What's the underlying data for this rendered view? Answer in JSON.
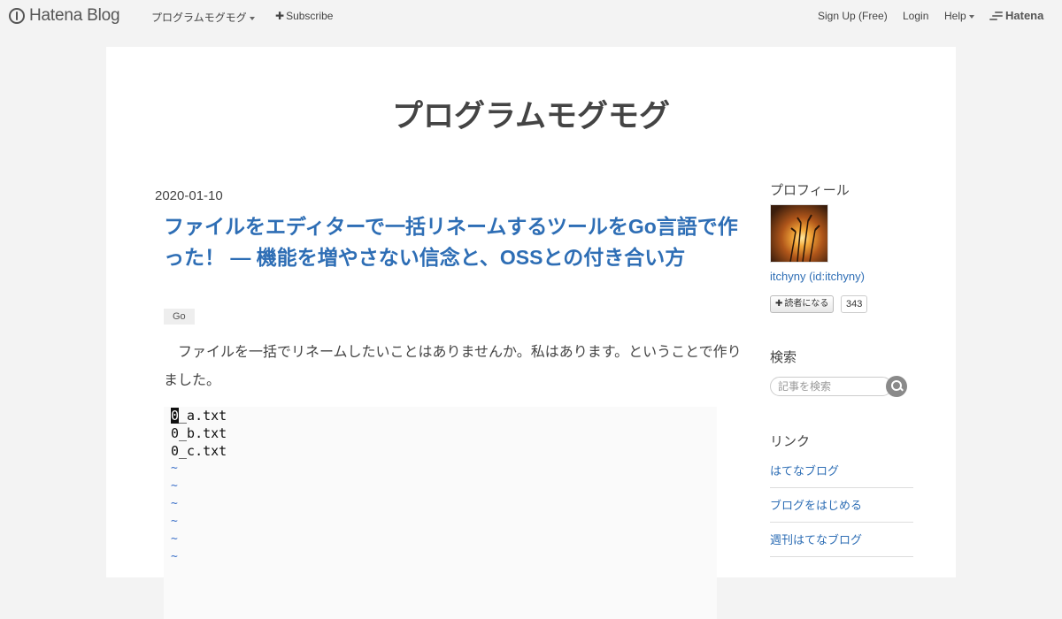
{
  "topbar": {
    "logo_text": "Hatena Blog",
    "blog_menu": "プログラムモグモグ",
    "subscribe": "Subscribe",
    "signup": "Sign Up (Free)",
    "login": "Login",
    "help": "Help",
    "brand": "Hatena"
  },
  "blog": {
    "title": "プログラムモグモグ"
  },
  "article": {
    "date": "2020-01-10",
    "title": "ファイルをエディターで一括リネームするツールをGo言語で作った！ — 機能を増やさない信念と、OSSとの付き合い方",
    "category": "Go",
    "paragraph": "ファイルを一括でリネームしたいことはありませんか。私はあります。ということで作りました。",
    "code": {
      "cursor_char": "0",
      "first_rest": "_a.txt",
      "lines": [
        "0_b.txt",
        "0_c.txt"
      ],
      "tildes": [
        "~",
        "~",
        "~",
        "~",
        "~",
        "~"
      ]
    }
  },
  "sidebar": {
    "profile_heading": "プロフィール",
    "profile_name": "itchyny (id:itchyny)",
    "reader_button": "読者になる",
    "reader_count": "343",
    "search_heading": "検索",
    "search_placeholder": "記事を検索",
    "links_heading": "リンク",
    "links": [
      "はてなブログ",
      "ブログをはじめる",
      "週刊はてなブログ"
    ]
  }
}
